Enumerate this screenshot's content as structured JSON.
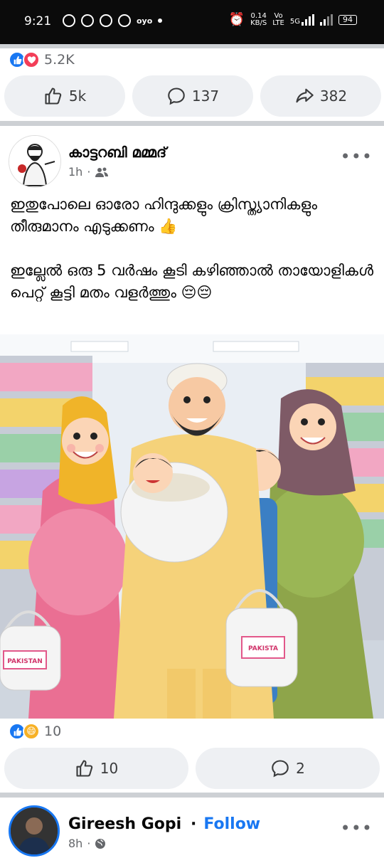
{
  "status_bar": {
    "time": "9:21",
    "net_speed": "0.14",
    "net_unit": "KB/S",
    "volte": "Vo",
    "lte": "LTE",
    "network": "5G",
    "battery": "94"
  },
  "top_post": {
    "reaction_count": "5.2K",
    "like_count": "5k",
    "comment_count": "137",
    "share_count": "382"
  },
  "post": {
    "author": "കാട്ടറബി മമ്മദ്",
    "time": "1h",
    "audience_icon": "friends-icon",
    "paragraph1": "ഇതുപോലെ ഓരോ ഹിന്ദുക്കളും ക്രിസ്ത്യാനികളും തീരുമാനം എടുക്കണം 👍",
    "paragraph2": "ഇല്ലേൽ ഒരു 5 വർഷം കൂടി കഴിഞ്ഞാൽ തായോളികൾ പെറ്റ് കൂട്ടി മതം വളർത്തും 😔😔",
    "image_bag_left": "PAKISTAN",
    "image_bag_right": "PAKISTA",
    "reaction_count": "10",
    "like_count": "10",
    "comment_count": "2"
  },
  "next_post": {
    "author": "Gireesh Gopi",
    "separator": "·",
    "follow_label": "Follow",
    "time": "8h",
    "audience_icon": "globe-icon"
  },
  "colors": {
    "facebook_blue": "#1877f2",
    "love_red": "#f33e58",
    "pill_bg": "#eef0f3",
    "divider": "#cdd0d4"
  }
}
